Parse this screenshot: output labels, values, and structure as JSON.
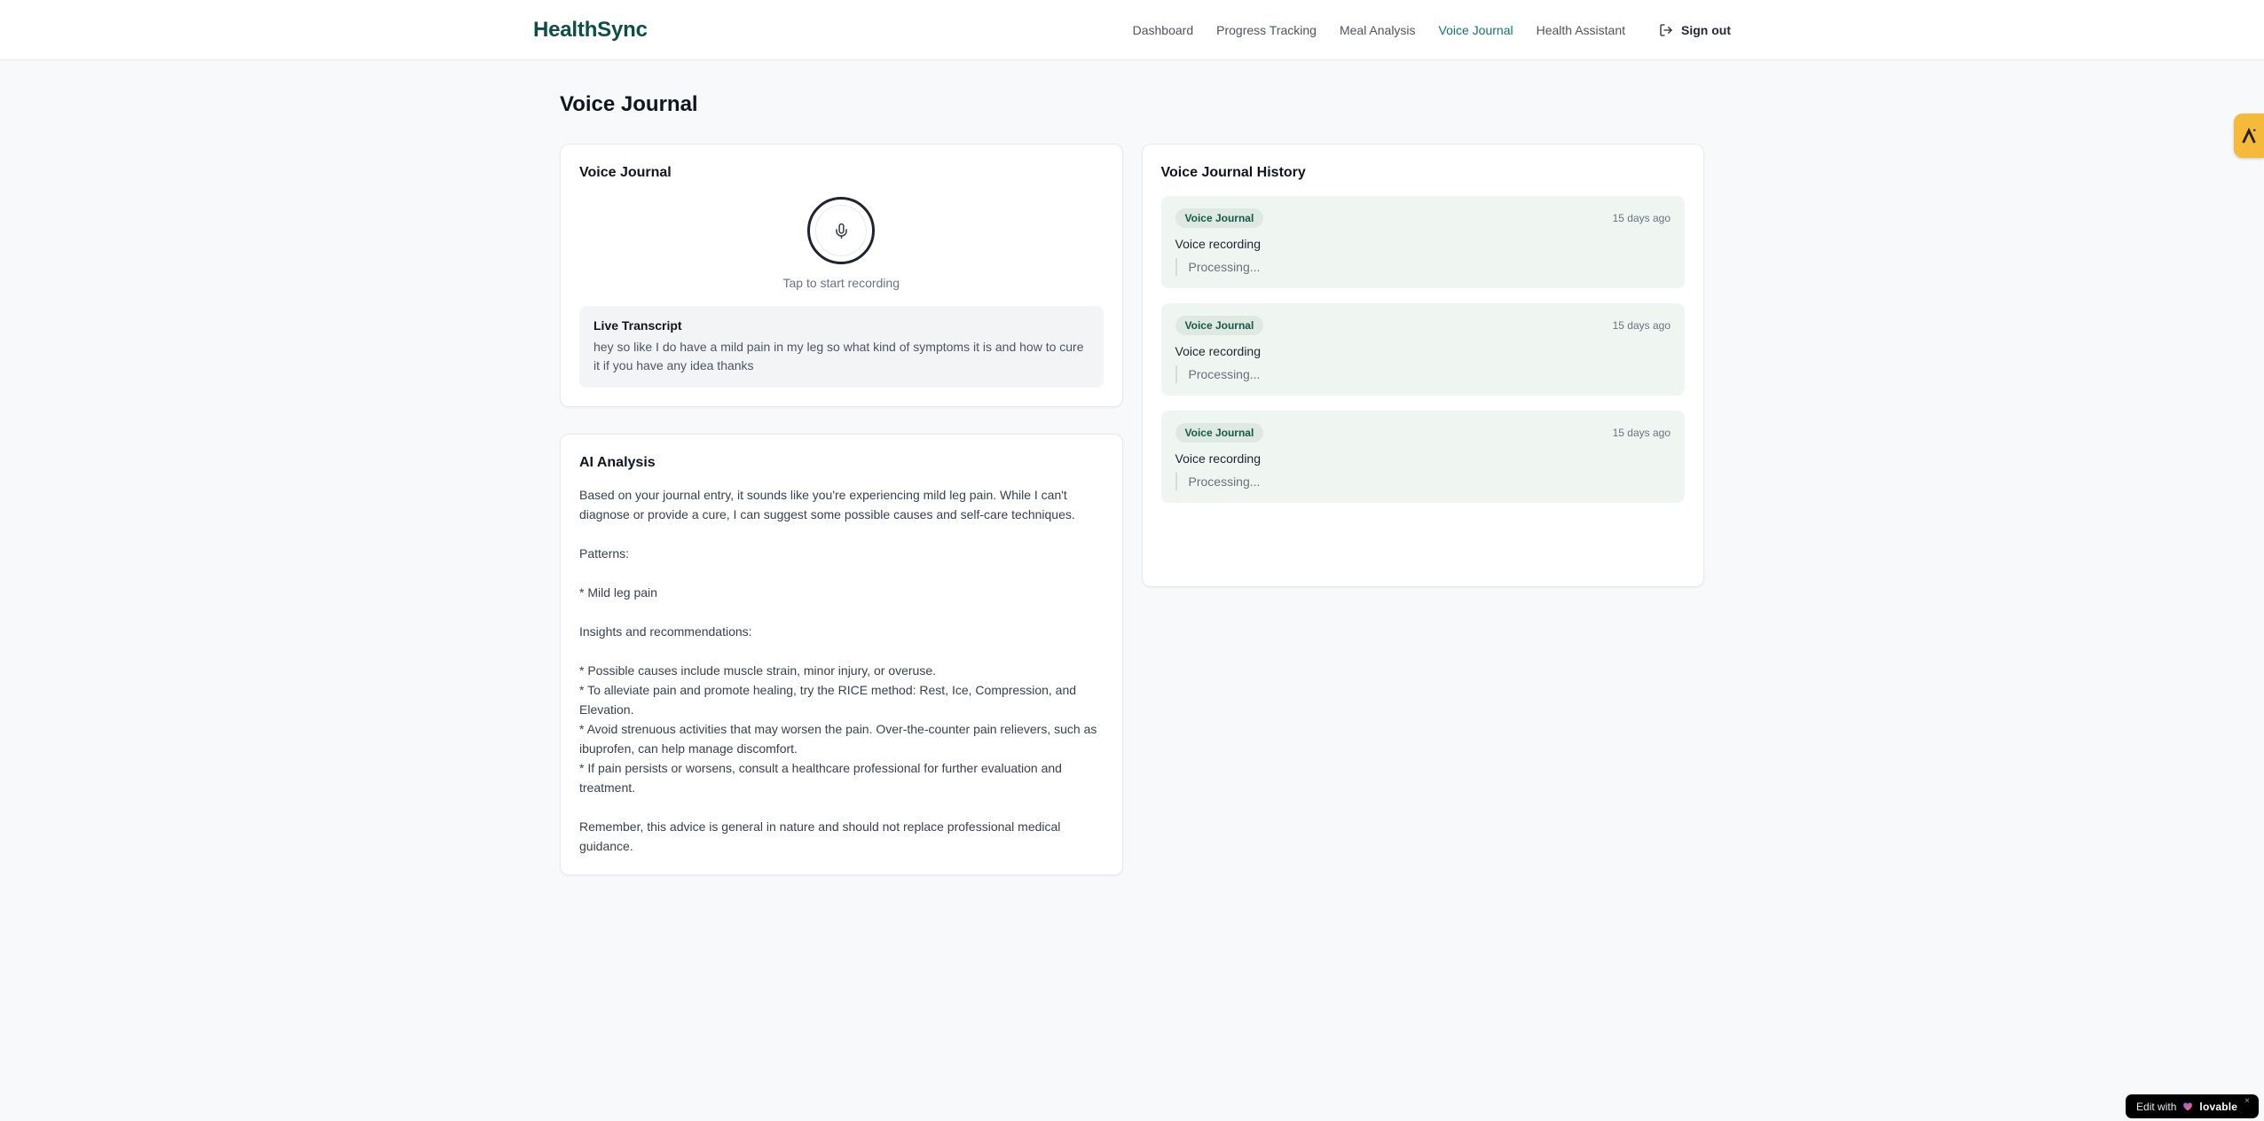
{
  "brand": {
    "name": "HealthSync"
  },
  "nav": {
    "items": [
      {
        "label": "Dashboard",
        "active": false
      },
      {
        "label": "Progress Tracking",
        "active": false
      },
      {
        "label": "Meal Analysis",
        "active": false
      },
      {
        "label": "Voice Journal",
        "active": true
      },
      {
        "label": "Health Assistant",
        "active": false
      }
    ],
    "sign_out_label": "Sign out"
  },
  "page": {
    "title": "Voice Journal"
  },
  "recorder_card": {
    "title": "Voice Journal",
    "tap_hint": "Tap to start recording",
    "transcript_title": "Live Transcript",
    "transcript_text": "hey so like I do have a mild pain in my leg so what kind of symptoms it is and how to cure it if you have any idea thanks"
  },
  "analysis_card": {
    "title": "AI Analysis",
    "body": "Based on your journal entry, it sounds like you're experiencing mild leg pain. While I can't diagnose or provide a cure, I can suggest some possible causes and self-care techniques.\n\nPatterns:\n\n* Mild leg pain\n\nInsights and recommendations:\n\n* Possible causes include muscle strain, minor injury, or overuse.\n* To alleviate pain and promote healing, try the RICE method: Rest, Ice, Compression, and Elevation.\n* Avoid strenuous activities that may worsen the pain. Over-the-counter pain relievers, such as ibuprofen, can help manage discomfort.\n* If pain persists or worsens, consult a healthcare professional for further evaluation and treatment.\n\nRemember, this advice is general in nature and should not replace professional medical guidance."
  },
  "history_card": {
    "title": "Voice Journal History",
    "entries": [
      {
        "badge": "Voice Journal",
        "time": "15 days ago",
        "label": "Voice recording",
        "status": "Processing..."
      },
      {
        "badge": "Voice Journal",
        "time": "15 days ago",
        "label": "Voice recording",
        "status": "Processing..."
      },
      {
        "badge": "Voice Journal",
        "time": "15 days ago",
        "label": "Voice recording",
        "status": "Processing..."
      }
    ]
  },
  "widgets": {
    "edit_badge": {
      "prefix": "Edit with",
      "brand": "lovable",
      "close": "×"
    }
  },
  "colors": {
    "brand_dark_teal": "#0c4f46",
    "nav_active_teal": "#0e766e",
    "page_background": "#f8f9fb",
    "history_entry_bg": "#eff6f1",
    "badge_bg": "#dde9e1",
    "badge_text": "#175949",
    "a11y_widget_orange": "#f6ba3a",
    "edit_badge_bg": "#000000"
  }
}
